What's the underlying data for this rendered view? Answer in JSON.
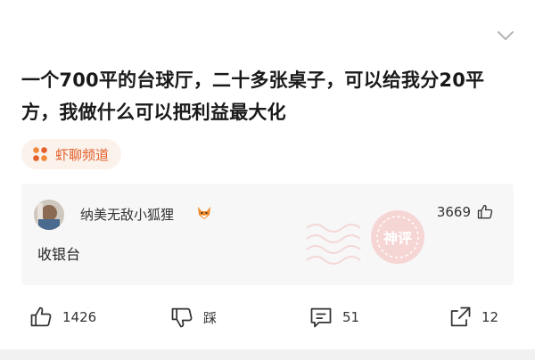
{
  "post": {
    "title": "一个700平的台球厅，二十多张桌子，可以给我分20平方，我做什么可以把利益最大化"
  },
  "channel": {
    "label": "虾聊频道",
    "accent": "#e2602b"
  },
  "top_comment": {
    "username": "纳美无敌小狐狸",
    "text": "收银台",
    "likes": "3669",
    "stamp_text": "神评"
  },
  "actions": {
    "like_count": "1426",
    "dislike_label": "踩",
    "comment_count": "51",
    "share_count": "12"
  },
  "icons": [
    "chevron-down-icon",
    "channel-grid-icon",
    "fox-emoji-icon",
    "thumbs-up-icon",
    "thumbs-down-icon",
    "comment-icon",
    "share-icon"
  ]
}
